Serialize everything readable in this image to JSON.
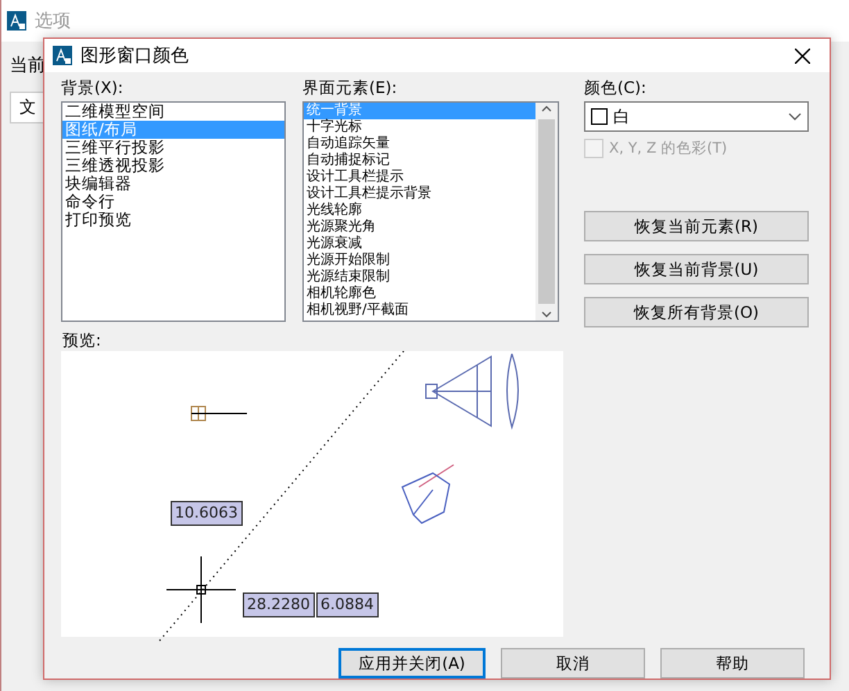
{
  "background_window": {
    "title": "选项",
    "label": "当前",
    "tab": "文"
  },
  "dialog": {
    "title": "图形窗口颜色"
  },
  "context": {
    "label": "背景(X):",
    "items": [
      {
        "label": "二维模型空间",
        "selected": false
      },
      {
        "label": "图纸/布局",
        "selected": true
      },
      {
        "label": "三维平行投影",
        "selected": false
      },
      {
        "label": "三维透视投影",
        "selected": false
      },
      {
        "label": "块编辑器",
        "selected": false
      },
      {
        "label": "命令行",
        "selected": false
      },
      {
        "label": "打印预览",
        "selected": false
      }
    ]
  },
  "elements": {
    "label": "界面元素(E):",
    "items": [
      {
        "label": "统一背景",
        "selected": true
      },
      {
        "label": "十字光标",
        "selected": false
      },
      {
        "label": "自动追踪矢量",
        "selected": false
      },
      {
        "label": "自动捕捉标记",
        "selected": false
      },
      {
        "label": "设计工具栏提示",
        "selected": false
      },
      {
        "label": "设计工具栏提示背景",
        "selected": false
      },
      {
        "label": "光线轮廓",
        "selected": false
      },
      {
        "label": "光源聚光角",
        "selected": false
      },
      {
        "label": "光源衰减",
        "selected": false
      },
      {
        "label": "光源开始限制",
        "selected": false
      },
      {
        "label": "光源结束限制",
        "selected": false
      },
      {
        "label": "相机轮廓色",
        "selected": false
      },
      {
        "label": "相机视野/平截面",
        "selected": false
      }
    ]
  },
  "color": {
    "label": "颜色(C):",
    "value": "白"
  },
  "tint_checkbox": {
    "label": "X, Y, Z 的色彩(T)",
    "checked": false,
    "disabled": true
  },
  "restore_buttons": [
    "恢复当前元素(R)",
    "恢复当前背景(U)",
    "恢复所有背景(O)"
  ],
  "preview": {
    "label": "预览:",
    "readouts": [
      "10.6063",
      "28.2280",
      "6.0884"
    ]
  },
  "buttons": [
    {
      "label": "应用并关闭(A)",
      "default": true
    },
    {
      "label": "取消",
      "default": false
    },
    {
      "label": "帮助",
      "default": false
    }
  ]
}
